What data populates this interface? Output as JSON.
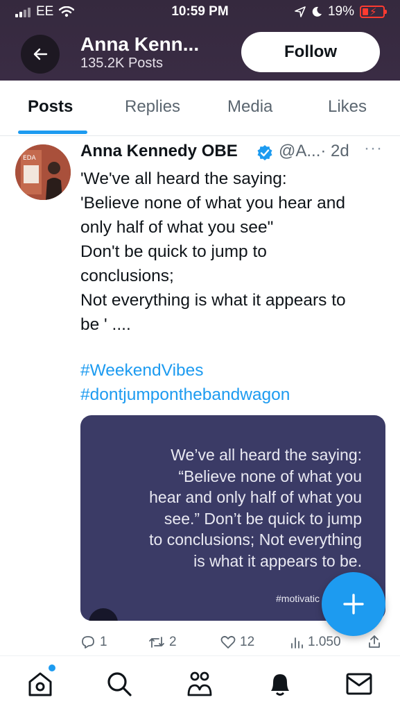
{
  "status_bar": {
    "carrier": "EE",
    "time": "10:59 PM",
    "battery_percent": "19%"
  },
  "header": {
    "profile_name": "Anna Kenn...",
    "post_count": "135.2K Posts",
    "follow_label": "Follow"
  },
  "tabs": [
    {
      "label": "Posts",
      "active": true
    },
    {
      "label": "Replies",
      "active": false
    },
    {
      "label": "Media",
      "active": false
    },
    {
      "label": "Likes",
      "active": false
    }
  ],
  "post": {
    "author_name": "Anna Kennedy OBE",
    "handle": "@A...",
    "time": "· 2d",
    "more": "···",
    "text_lines": [
      "'We've all heard the saying:",
      "'Believe none of what you hear and",
      "only half of what you see\"",
      "Don't be quick to jump to",
      "conclusions;",
      "Not everything is what it appears to",
      "be ' ...."
    ],
    "hashtags": [
      "#WeekendVibes",
      "#dontjumponthebandwagon"
    ],
    "media": {
      "quote_lines": [
        "We’ve all heard the saying:",
        "“Believe none of what you",
        "hear and only half of what you",
        "see.” Don’t be quick to jump",
        "to conclusions; Not everything",
        "is what it appears to be."
      ],
      "tag": "#motivatic"
    },
    "stats": {
      "replies": "1",
      "reposts": "2",
      "likes": "12",
      "views": "1.050"
    }
  },
  "bottom_nav": [
    "home",
    "search",
    "communities",
    "notifications",
    "messages"
  ],
  "colors": {
    "header_bg": "#35293e",
    "accent": "#1d9bf0",
    "media_bg": "#3b3b66"
  }
}
